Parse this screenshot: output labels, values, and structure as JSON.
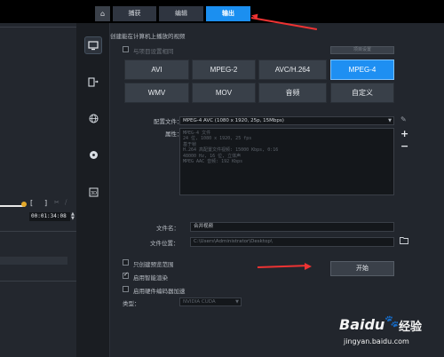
{
  "tabs": {
    "home_icon": "home-icon",
    "capture": "捕获",
    "edit": "编辑",
    "output": "输出"
  },
  "left_panel": {
    "timecode": "00:01:34:08"
  },
  "side_icons": [
    "computer-icon",
    "device-icon",
    "globe-icon",
    "disc-icon",
    "3d-icon"
  ],
  "main": {
    "heading": "创建能在计算机上播放的视频",
    "match_project_label": "与项目设置相同",
    "top_right_button": "项目设置",
    "formats_row1": [
      "AVI",
      "MPEG-2",
      "AVC/H.264",
      "MPEG-4"
    ],
    "formats_row2": [
      "WMV",
      "MOV",
      "音频",
      "自定义"
    ],
    "selected_format": "MPEG-4",
    "config_file_label": "配置文件：",
    "config_file_value": "MPEG-4 AVC (1080 x 1920, 25p, 15Mbps)",
    "properties_label": "属性：",
    "properties_lines": [
      "MPEG-4 文件",
      "24 位, 1080 x 1920, 25 fps",
      "基于帧",
      "H.264 高配置文件视频: 15000 Kbps, 0:16",
      "48000 Hz, 16 位, 立体声",
      "MPEG AAC 音频: 192 Kbps"
    ],
    "filename_label": "文件名：",
    "filename_value": "合并视频",
    "location_label": "文件位置：",
    "location_value": "C:\\Users\\Administrator\\Desktop\\",
    "preview_range_label": "只创建预览范围",
    "smart_render_label": "启用智能渲染",
    "hw_accel_label": "启用硬件编码器加速",
    "type_label": "类型：",
    "type_value": "NVIDIA CUDA",
    "start_button": "开始"
  },
  "watermark": {
    "brand": "Baidu",
    "cn": "经验",
    "url": "jingyan.baidu.com"
  },
  "colors": {
    "accent": "#1e8ff2",
    "arrow": "#e33333"
  }
}
